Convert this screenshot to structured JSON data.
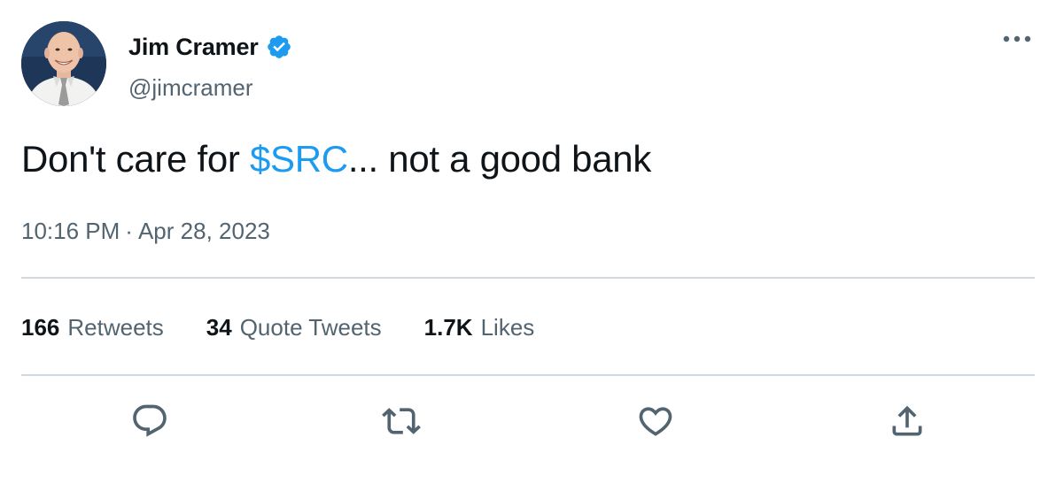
{
  "author": {
    "display_name": "Jim Cramer",
    "handle": "@jimcramer",
    "verified": true
  },
  "tweet": {
    "text_before": "Don't care for ",
    "cashtag": "$SRC",
    "text_after": "... not a good bank",
    "time": "10:16 PM",
    "separator": "·",
    "date": "Apr 28, 2023"
  },
  "stats": {
    "retweets_count": "166",
    "retweets_label": "Retweets",
    "quotes_count": "34",
    "quotes_label": "Quote Tweets",
    "likes_count": "1.7K",
    "likes_label": "Likes"
  },
  "icons": {
    "verified": "verified-badge-icon",
    "more": "more-horizontal-icon",
    "reply": "reply-icon",
    "retweet": "retweet-icon",
    "like": "heart-icon",
    "share": "share-icon"
  },
  "colors": {
    "accent": "#1d9bf0",
    "text_primary": "#0f1419",
    "text_secondary": "#536471",
    "divider": "#cfd9de"
  }
}
